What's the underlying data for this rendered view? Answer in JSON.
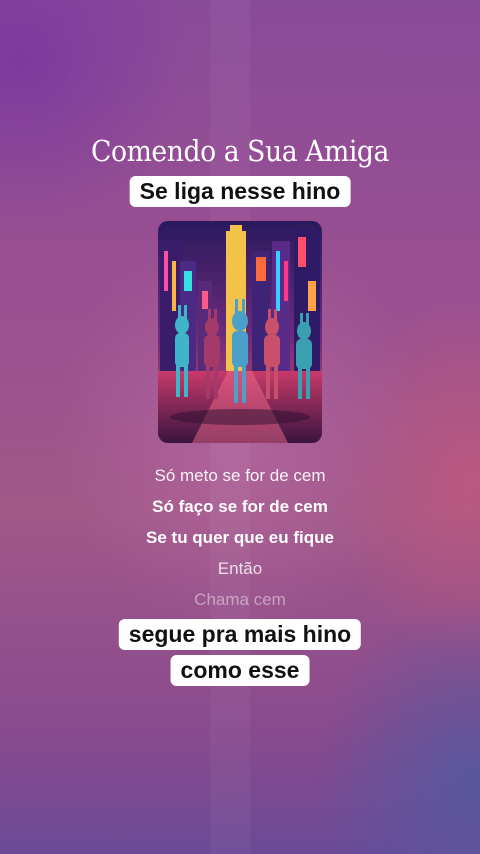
{
  "song": {
    "title": "Comendo a Sua Amiga"
  },
  "captions": {
    "top": "Se liga nesse hino",
    "bottom_line1": "segue pra mais hino",
    "bottom_line2": "como esse"
  },
  "lyrics": [
    "Só meto se for de cem",
    "Só faço se for de cem",
    "Se tu quer que eu fique",
    "Então",
    "Chama cem"
  ],
  "colors": {
    "background_top": "#8a4a9a",
    "background_bottom": "#6c4a96",
    "caption_bg": "#ffffff",
    "caption_text": "#111111"
  },
  "icons": {
    "cover_art": "album-cover-dancing-bunnies-neon-city"
  }
}
